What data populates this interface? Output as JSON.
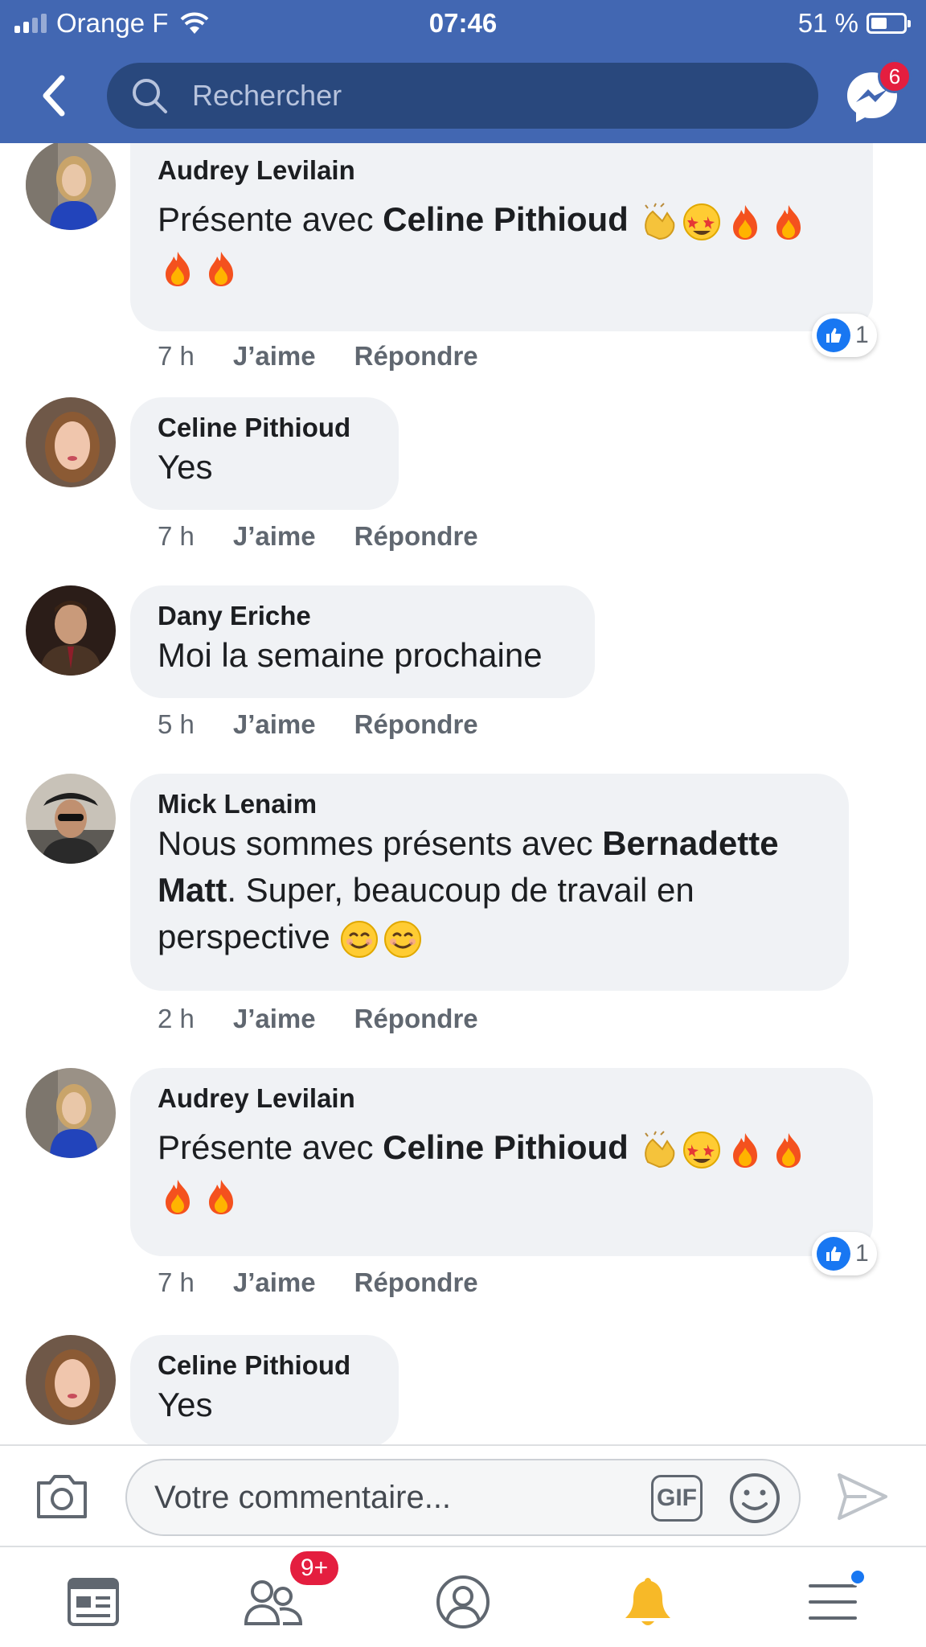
{
  "status_bar": {
    "carrier": "Orange F",
    "time": "07:46",
    "battery": "51 %",
    "battery_level": 0.51
  },
  "header": {
    "search_placeholder": "Rechercher",
    "messenger_badge": "6"
  },
  "comments": [
    {
      "author": "Audrey Levilain",
      "pre": "Présente avec ",
      "mention": "Celine Pithioud",
      "post": "",
      "emojis_line1": [
        "clap",
        "star-struck",
        "fire",
        "fire"
      ],
      "emojis_line2": [
        "fire",
        "fire"
      ],
      "time": "7 h",
      "like": "J’aime",
      "reply": "Répondre",
      "reactions": "1",
      "avatar": "audrey"
    },
    {
      "author": "Celine Pithioud",
      "text": "Yes",
      "time": "7 h",
      "like": "J’aime",
      "reply": "Répondre",
      "avatar": "celine"
    },
    {
      "author": "Dany Eriche",
      "text": "Moi la semaine prochaine",
      "time": "5 h",
      "like": "J’aime",
      "reply": "Répondre",
      "avatar": "dany"
    },
    {
      "author": "Mick Lenaim",
      "pre": "Nous sommes présents avec ",
      "mention_a": "Bernadette",
      "mention_b": "Matt",
      "post_line2": ". Super, beaucoup de travail en",
      "post_line3": "perspective ",
      "emojis": [
        "smile",
        "smile"
      ],
      "time": "2 h",
      "like": "J’aime",
      "reply": "Répondre",
      "avatar": "mick"
    },
    {
      "author": "Audrey Levilain",
      "pre": "Présente avec ",
      "mention": "Celine Pithioud",
      "post": "",
      "emojis_line1": [
        "clap",
        "star-struck",
        "fire",
        "fire"
      ],
      "emojis_line2": [
        "fire",
        "fire"
      ],
      "time": "7 h",
      "like": "J’aime",
      "reply": "Répondre",
      "reactions": "1",
      "avatar": "audrey"
    },
    {
      "author": "Celine Pithioud",
      "text": "Yes",
      "avatar": "celine"
    }
  ],
  "composer": {
    "placeholder": "Votre commentaire...",
    "gif_label": "GIF"
  },
  "bottom_nav": {
    "friends_badge": "9+",
    "items": [
      "news-feed",
      "friends",
      "profile",
      "notifications",
      "menu"
    ]
  },
  "colors": {
    "brand": "#4267b2",
    "search_bg": "#29487d",
    "badge": "#e41e3f",
    "like": "#1877f2",
    "bubble": "#f0f2f5",
    "notification_bell": "#f7b928"
  }
}
